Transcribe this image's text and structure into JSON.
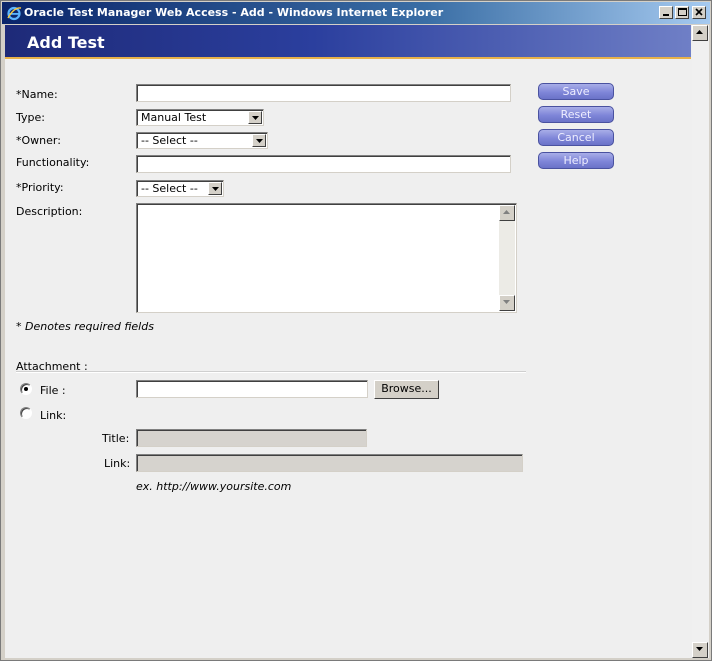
{
  "window": {
    "title": "Oracle Test Manager Web Access - Add - Windows Internet Explorer"
  },
  "page": {
    "heading": "Add Test"
  },
  "form": {
    "name": {
      "label": "*Name:",
      "value": ""
    },
    "type": {
      "label": "Type:",
      "selected": "Manual Test"
    },
    "owner": {
      "label": "*Owner:",
      "selected": "-- Select --"
    },
    "functionality": {
      "label": "Functionality:",
      "value": ""
    },
    "priority": {
      "label": "*Priority:",
      "selected": "-- Select --"
    },
    "description": {
      "label": "Description:",
      "value": ""
    },
    "required_note": "* Denotes required fields"
  },
  "actions": {
    "save": "Save",
    "reset": "Reset",
    "cancel": "Cancel",
    "help": "Help"
  },
  "attachment": {
    "label": "Attachment :",
    "file_label": "File :",
    "file_selected": true,
    "browse": "Browse...",
    "link_label": "Link:",
    "title_label": "Title:",
    "link_field_label": "Link:",
    "example": "ex. http://www.yoursite.com"
  },
  "colors": {
    "banner": "#2b3f9e",
    "banner_accent": "#e8b24a",
    "action_button": "#7f86d8",
    "titlebar": "#0a246a"
  }
}
